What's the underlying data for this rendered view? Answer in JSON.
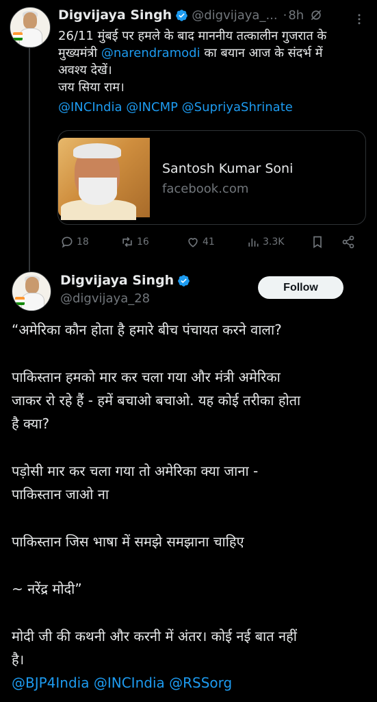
{
  "colors": {
    "background": "#000000",
    "text": "#e7e9ea",
    "muted": "#71767b",
    "link": "#1d9bf0",
    "verified": "#1d9bf0",
    "border": "#2f3336"
  },
  "tweet1": {
    "author_name": "Digvijaya Singh",
    "handle": "@digvijaya_...",
    "separator": "·",
    "time": "8h",
    "lines": [
      "26/11 मुंबई पर हमले के बाद माननीय तत्कालीन गुजरात के",
      "मुख्यमंत्री ",
      "@narendramodi",
      " का बयान आज के संदर्भ में",
      "अवश्य देखें।",
      "जय सिया राम।"
    ],
    "mentions_line": "@INCIndia @INCMP @SupriyaShrinate",
    "card": {
      "title": "Santosh Kumar Soni",
      "domain": "facebook.com"
    },
    "stats": {
      "replies": "18",
      "reposts": "16",
      "likes": "41",
      "views": "3.3K"
    },
    "icons": [
      "reply-icon",
      "repost-icon",
      "like-icon",
      "views-icon",
      "bookmark-icon",
      "share-icon",
      "more-icon",
      "no-notify-icon",
      "verified-icon"
    ]
  },
  "tweet2": {
    "author_name": "Digvijaya Singh",
    "handle": "@digvijaya_28",
    "follow_label": "Follow",
    "paragraphs": [
      "“अमेरिका कौन होता है हमारे बीच पंचायत करने वाला?",
      "पाकिस्तान हमको मार कर चला गया और मंत्री अमेरिका",
      "जाकर रो रहे हैं - हमें बचाओ बचाओ. यह कोई तरीका होता",
      "है क्या?",
      "पड़ोसी मार कर चला गया तो अमेरिका क्या जाना -",
      "पाकिस्तान जाओ ना",
      "पाकिस्तान जिस भाषा में समझे समझाना चाहिए",
      "~ नरेंद्र मोदी”",
      "मोदी जी की कथनी और करनी में अंतर। कोई नई बात नहीं",
      "है।",
      "@BJP4India @INCIndia @RSSorg"
    ]
  }
}
